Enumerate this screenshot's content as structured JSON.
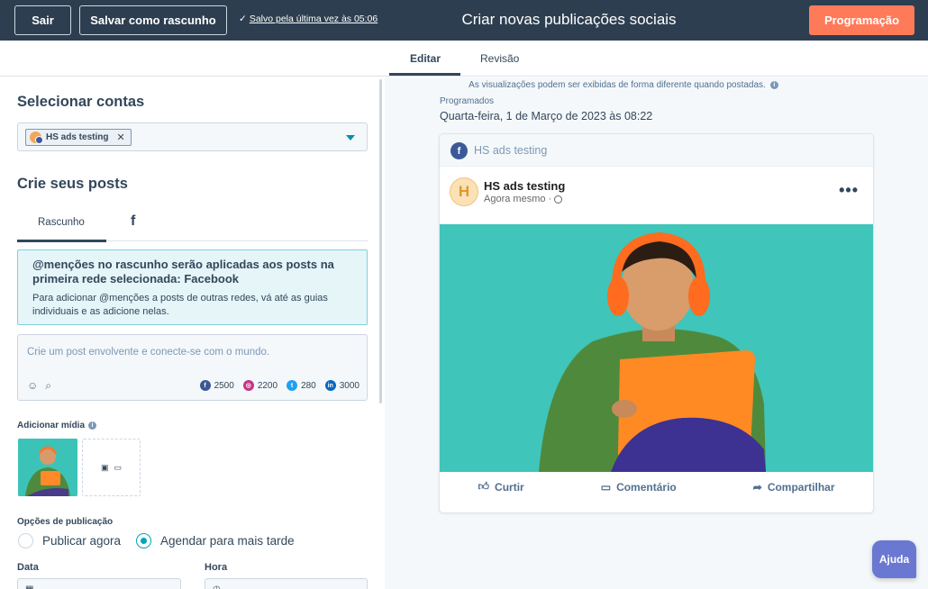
{
  "topbar": {
    "exit_label": "Sair",
    "save_draft_label": "Salvar como rascunho",
    "saved_status": "Salvo pela última vez às 05:06",
    "title": "Criar novas publicações sociais",
    "schedule_label": "Programação"
  },
  "tabs": [
    {
      "label": "Editar",
      "active": true
    },
    {
      "label": "Revisão",
      "active": false
    }
  ],
  "left": {
    "select_accounts_title": "Selecionar contas",
    "selected_account": "HS ads testing",
    "create_posts_title": "Crie seus posts",
    "subtabs": [
      {
        "label": "Rascunho"
      },
      {
        "label": "f"
      }
    ],
    "alert": {
      "title": "@menções no rascunho serão aplicadas aos posts na primeira rede selecionada: Facebook",
      "body": "Para adicionar @menções a posts de outras redes, vá até as guias individuais e as adicione nelas."
    },
    "composer": {
      "placeholder": "Crie um post envolvente e conecte-se com o mundo.",
      "counts": [
        {
          "network": "facebook",
          "value": "2500",
          "color": "#3b5998",
          "glyph": "f"
        },
        {
          "network": "instagram",
          "value": "2200",
          "color": "#c13584",
          "glyph": "◎"
        },
        {
          "network": "twitter",
          "value": "280",
          "color": "#1da1f2",
          "glyph": "t"
        },
        {
          "network": "linkedin",
          "value": "3000",
          "color": "#0a66c2",
          "glyph": "in"
        }
      ]
    },
    "add_media_label": "Adicionar mídia",
    "publish_options_label": "Opções de publicação",
    "publish_now_label": "Publicar agora",
    "schedule_later_label": "Agendar para mais tarde",
    "date_label": "Data",
    "time_label": "Hora"
  },
  "preview": {
    "note": "As visualizações podem ser exibidas de forma diferente quando postadas.",
    "scheduled_label": "Programados",
    "scheduled_date": "Quarta-feira, 1 de Março de 2023 às 08:22",
    "account_name": "HS ads testing",
    "avatar_letter": "H",
    "post_author": "HS ads testing",
    "post_time": "Agora mesmo ·",
    "actions": {
      "like": "Curtir",
      "comment": "Comentário",
      "share": "Compartilhar"
    }
  },
  "help_label": "Ajuda",
  "colors": {
    "navy": "#2d3e50",
    "accent": "#ff7a59",
    "teal": "#00a4bd",
    "help": "#6a78d1"
  }
}
